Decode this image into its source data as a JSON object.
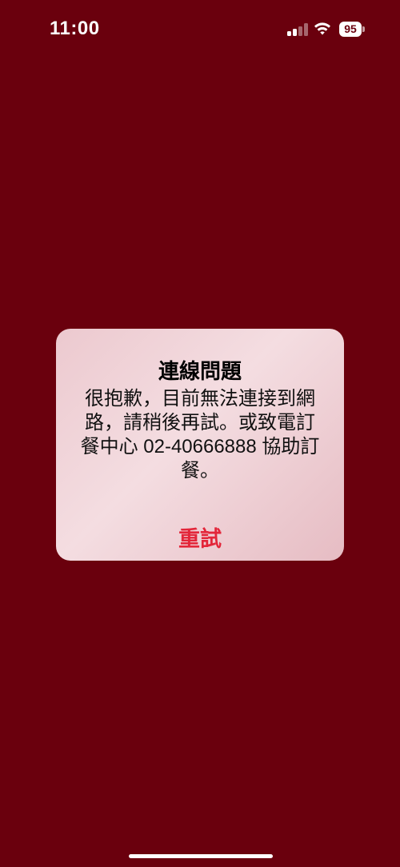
{
  "status_bar": {
    "time": "11:00",
    "battery_level": "95",
    "signal_icon": "cellular-signal-icon",
    "wifi_icon": "wifi-icon",
    "battery_icon": "battery-icon"
  },
  "alert": {
    "title": "連線問題",
    "message": "很抱歉，目前無法連接到網路，請稍後再試。或致電訂餐中心 02-40666888 協助訂餐。",
    "retry_label": "重試"
  },
  "colors": {
    "background": "#6a000d",
    "alert_bg": "#f0d6da",
    "button_text": "#e3263a"
  }
}
